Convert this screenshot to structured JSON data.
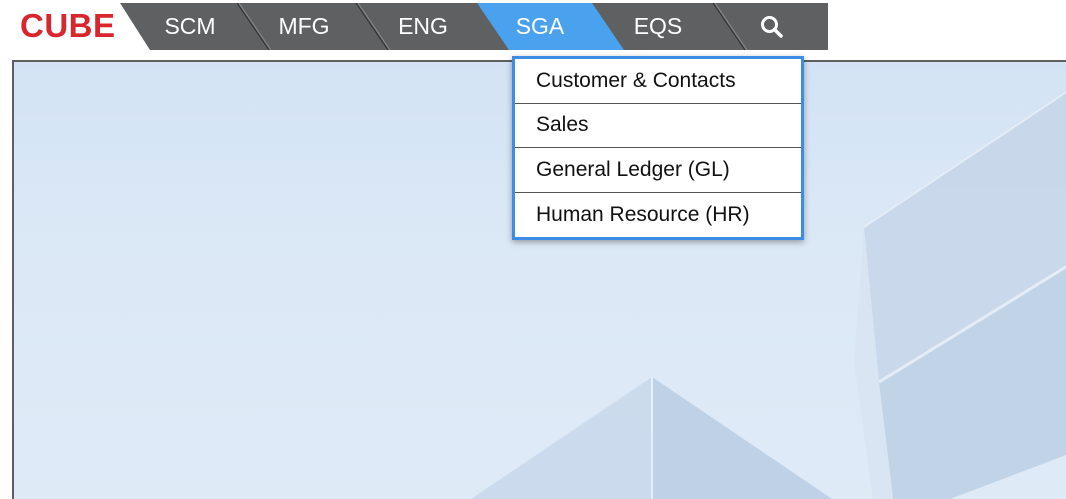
{
  "brand": {
    "logo": "CUBE",
    "logo_color": "#d9262d"
  },
  "nav": {
    "bar_color": "#5f6062",
    "active_color": "#4aa1ee",
    "tabs": [
      {
        "label": "SCM",
        "active": false
      },
      {
        "label": "MFG",
        "active": false
      },
      {
        "label": "ENG",
        "active": false
      },
      {
        "label": "SGA",
        "active": true
      },
      {
        "label": "EQS",
        "active": false
      }
    ],
    "search_icon": "magnifier-icon"
  },
  "dropdown": {
    "open_under": "SGA",
    "border_color": "#3d8ce6",
    "items": [
      "Customer & Contacts",
      "Sales",
      "General Ledger (GL)",
      "Human Resource (HR)"
    ]
  }
}
